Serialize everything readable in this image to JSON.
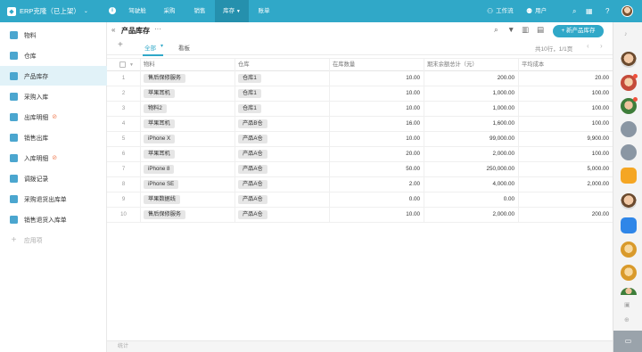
{
  "topbar": {
    "app_title": "ERP克隆（已上架）",
    "brand_icon": "cube-icon",
    "nav": [
      "驾驶舱",
      "采购",
      "销售",
      "库存",
      "账单"
    ],
    "active_nav": "库存",
    "workflow_label": "工作流",
    "users_label": "用户",
    "accent_color": "#30a8c8"
  },
  "sidebar": {
    "items": [
      {
        "label": "物料",
        "icon": "cube-icon"
      },
      {
        "label": "仓库",
        "icon": "warehouse-icon"
      },
      {
        "label": "产品库存",
        "icon": "inventory-icon"
      },
      {
        "label": "采购入库",
        "icon": "cart-icon"
      },
      {
        "label": "出库明细",
        "icon": "document-icon",
        "hidden_marker": "eye-off-icon"
      },
      {
        "label": "销售出库",
        "icon": "cart-icon"
      },
      {
        "label": "入库明细",
        "icon": "document-icon",
        "hidden_marker": "eye-off-icon"
      },
      {
        "label": "调拨记录",
        "icon": "list-icon"
      },
      {
        "label": "采购退货出库单",
        "icon": "return-icon"
      },
      {
        "label": "销售退货入库单",
        "icon": "edit-icon"
      }
    ],
    "add_app_label": "应用项",
    "active_item": "产品库存"
  },
  "main": {
    "title": "产品库存",
    "new_button": "+ 新产品库存",
    "tabs": [
      "全部",
      "看板"
    ],
    "pager_text": "共10行，1/1页",
    "footer_label": "统计"
  },
  "table": {
    "columns": [
      "物料",
      "仓库",
      "在库数量",
      "期末余额总计（元）",
      "平均成本"
    ],
    "rows": [
      {
        "n": "1",
        "material": "售后保修服务",
        "warehouse": "仓库1",
        "qty": "10.00",
        "balance": "200.00",
        "cost": "20.00"
      },
      {
        "n": "2",
        "material": "苹果耳机",
        "warehouse": "仓库1",
        "qty": "10.00",
        "balance": "1,000.00",
        "cost": "100.00"
      },
      {
        "n": "3",
        "material": "物料2",
        "warehouse": "仓库1",
        "qty": "10.00",
        "balance": "1,000.00",
        "cost": "100.00"
      },
      {
        "n": "4",
        "material": "苹果耳机",
        "warehouse": "产品B仓",
        "qty": "16.00",
        "balance": "1,600.00",
        "cost": "100.00"
      },
      {
        "n": "5",
        "material": "iPhone X",
        "warehouse": "产品A仓",
        "qty": "10.00",
        "balance": "99,000.00",
        "cost": "9,900.00"
      },
      {
        "n": "6",
        "material": "苹果耳机",
        "warehouse": "产品A仓",
        "qty": "20.00",
        "balance": "2,000.00",
        "cost": "100.00"
      },
      {
        "n": "7",
        "material": "iPhone 8",
        "warehouse": "产品A仓",
        "qty": "50.00",
        "balance": "250,000.00",
        "cost": "5,000.00"
      },
      {
        "n": "8",
        "material": "iPhone SE",
        "warehouse": "产品A仓",
        "qty": "2.00",
        "balance": "4,000.00",
        "cost": "2,000.00"
      },
      {
        "n": "9",
        "material": "苹果数据线",
        "warehouse": "产品A仓",
        "qty": "0.00",
        "balance": "0.00",
        "cost": ""
      },
      {
        "n": "10",
        "material": "售后保修服务",
        "warehouse": "产品A仓",
        "qty": "10.00",
        "balance": "2,000.00",
        "cost": "200.00"
      }
    ]
  }
}
